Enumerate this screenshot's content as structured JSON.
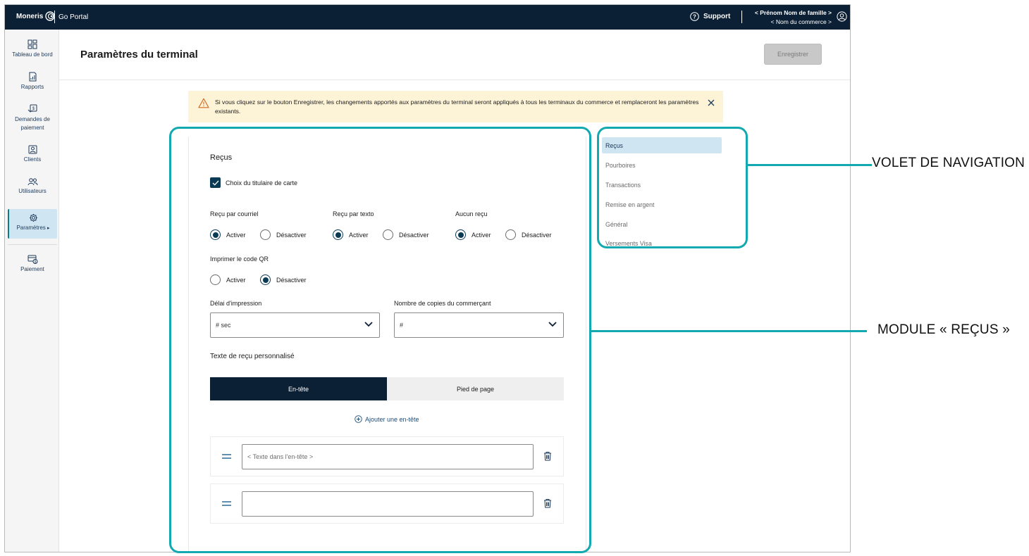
{
  "topbar": {
    "brand": "Moneris",
    "portal": "Go Portal",
    "support_label": "Support",
    "user_name": "< Prénom Nom de famille >",
    "merchant_name": "< Nom du commerce >"
  },
  "sidebar": {
    "items": [
      {
        "label": "Tableau de bord",
        "icon": "dashboard-icon"
      },
      {
        "label": "Rapports",
        "icon": "report-icon"
      },
      {
        "label": "Demandes de paiement",
        "icon": "payment-request-icon"
      },
      {
        "label": "Clients",
        "icon": "client-icon"
      },
      {
        "label": "Utilisateurs",
        "icon": "users-icon"
      },
      {
        "label": "Paramètres",
        "icon": "gear-icon",
        "active": true
      },
      {
        "label": "Paiement",
        "icon": "payment-icon"
      }
    ]
  },
  "header": {
    "title": "Paramètres du terminal",
    "save_label": "Enregistrer"
  },
  "banner": {
    "text": "Si vous cliquez sur le bouton Enregistrer, les changements apportés aux paramètres du terminal seront appliqués à tous les terminaux du commerce et remplaceront les paramètres existants."
  },
  "receipts": {
    "title": "Reçus",
    "cardholder_choice": "Choix du titulaire de carte",
    "groups": [
      {
        "label": "Reçu par courriel",
        "selected": "Activer"
      },
      {
        "label": "Reçu par texto",
        "selected": "Activer"
      },
      {
        "label": "Aucun reçu",
        "selected": "Activer"
      },
      {
        "label": "Imprimer le code QR",
        "selected": "Désactiver"
      }
    ],
    "option_on": "Activer",
    "option_off": "Désactiver",
    "print_delay_label": "Délai d'impression",
    "print_delay_value": "# sec",
    "copies_label": "Nombre de copies du commerçant",
    "copies_value": "#",
    "custom_text_label": "Texte de reçu personnalisé",
    "tab_header": "En-tête",
    "tab_footer": "Pied de page",
    "add_header": "Ajouter une en-tête",
    "header_placeholder": "< Texte dans l'en-tête >"
  },
  "subnav": {
    "items": [
      "Reçus",
      "Pourboires",
      "Transactions",
      "Remise en argent",
      "Général",
      "Versements Visa"
    ]
  },
  "annotations": {
    "nav_panel": "VOLET DE NAVIGATION",
    "receipts_module": "MODULE « REÇUS »"
  },
  "colors": {
    "navy": "#0b1f35",
    "teal_highlight": "#13a9b0",
    "active_nav": "#cfe6f2",
    "banner_bg": "#fdf3d7"
  }
}
